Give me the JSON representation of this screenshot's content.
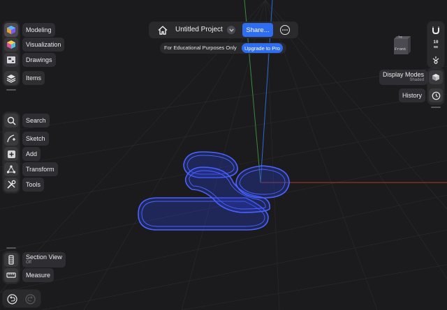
{
  "header": {
    "project_title": "Untitled Project",
    "share_label": "Share...",
    "edu_text": "For Educational Purposes Only",
    "upgrade_label": "Upgrade to Pro"
  },
  "sidebar": {
    "workspaces": [
      {
        "label": "Modeling",
        "icon": "modeling-icon"
      },
      {
        "label": "Visualization",
        "icon": "visualization-icon"
      },
      {
        "label": "Drawings",
        "icon": "drawings-icon"
      },
      {
        "label": "Items",
        "icon": "layers-icon"
      }
    ],
    "tools": [
      {
        "label": "Search",
        "icon": "search-icon"
      },
      {
        "label": "Sketch",
        "icon": "sketch-icon"
      },
      {
        "label": "Add",
        "icon": "add-icon"
      },
      {
        "label": "Transform",
        "icon": "transform-icon"
      },
      {
        "label": "Tools",
        "icon": "tools-icon"
      }
    ],
    "bottom": [
      {
        "label": "Section View",
        "sublabel": "Off",
        "icon": "section-view-icon"
      },
      {
        "label": "Measure",
        "icon": "measure-icon"
      }
    ]
  },
  "right_panel": {
    "view_cube_top": "Top",
    "view_cube_front": "Front",
    "snap_value": "10",
    "snap_unit": "mm",
    "display_modes_label": "Display Modes",
    "display_modes_value": "Shaded",
    "history_label": "History"
  },
  "colors": {
    "accent": "#2f6df0",
    "background": "#1b1b1d",
    "panel": "#2a2a2d",
    "sketch_stroke": "#4a63ff",
    "axis_x": "#b03a2e",
    "axis_y": "#3c8a3c",
    "axis_z": "#2b6bd6"
  }
}
